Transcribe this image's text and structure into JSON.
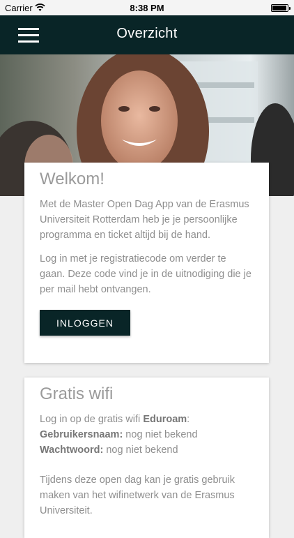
{
  "status_bar": {
    "carrier": "Carrier",
    "time": "8:38 PM"
  },
  "header": {
    "title": "Overzicht"
  },
  "welcome_card": {
    "title": "Welkom!",
    "paragraph1": "Met de Master Open Dag App van de Erasmus Universiteit Rotterdam heb je je persoonlijke programma en ticket altijd bij de hand.",
    "paragraph2": "Log in met je registratiecode om verder te gaan. Deze code vind je in de uitnodiging die je per mail hebt ontvangen.",
    "login_button": "INLOGGEN"
  },
  "wifi_card": {
    "title": "Gratis wifi",
    "intro": "Log in op de gratis wifi ",
    "network_name": "Eduroam",
    "intro_end": ":",
    "username_label": "Gebruikersnaam:",
    "username_value": " nog niet bekend",
    "password_label": "Wachtwoord:",
    "password_value": " nog niet bekend",
    "info": "Tijdens deze open dag kan je gratis gebruik maken van het wifinetwerk van de Erasmus Universiteit."
  }
}
